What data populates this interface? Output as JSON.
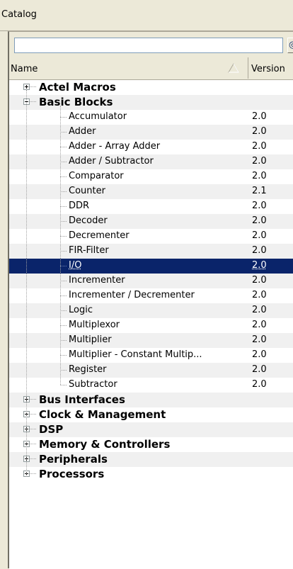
{
  "panel": {
    "title": "Catalog"
  },
  "search": {
    "value": ""
  },
  "columns": {
    "name": "Name",
    "version": "Version"
  },
  "tree": [
    {
      "label": "Actel Macros",
      "expanded": false,
      "children": []
    },
    {
      "label": "Basic Blocks",
      "expanded": true,
      "children": [
        {
          "label": "Accumulator",
          "version": "2.0"
        },
        {
          "label": "Adder",
          "version": "2.0"
        },
        {
          "label": "Adder - Array Adder",
          "version": "2.0"
        },
        {
          "label": "Adder / Subtractor",
          "version": "2.0"
        },
        {
          "label": "Comparator",
          "version": "2.0"
        },
        {
          "label": "Counter",
          "version": "2.1"
        },
        {
          "label": "DDR",
          "version": "2.0"
        },
        {
          "label": "Decoder",
          "version": "2.0"
        },
        {
          "label": "Decrementer",
          "version": "2.0"
        },
        {
          "label": "FIR-Filter",
          "version": "2.0"
        },
        {
          "label": "I/O",
          "version": "2.0",
          "selected": true
        },
        {
          "label": "Incrementer",
          "version": "2.0"
        },
        {
          "label": "Incrementer / Decrementer",
          "version": "2.0"
        },
        {
          "label": "Logic",
          "version": "2.0"
        },
        {
          "label": "Multiplexor",
          "version": "2.0"
        },
        {
          "label": "Multiplier",
          "version": "2.0"
        },
        {
          "label": "Multiplier - Constant Multip...",
          "version": "2.0"
        },
        {
          "label": "Register",
          "version": "2.0"
        },
        {
          "label": "Subtractor",
          "version": "2.0"
        }
      ]
    },
    {
      "label": "Bus Interfaces",
      "expanded": false,
      "children": []
    },
    {
      "label": "Clock & Management",
      "expanded": false,
      "children": []
    },
    {
      "label": "DSP",
      "expanded": false,
      "children": []
    },
    {
      "label": "Memory & Controllers",
      "expanded": false,
      "children": []
    },
    {
      "label": "Peripherals",
      "expanded": false,
      "children": []
    },
    {
      "label": "Processors",
      "expanded": false,
      "children": []
    }
  ],
  "colors": {
    "selection": "#0a246a",
    "alt_row": "#f0f0f0",
    "chrome": "#ece9d8"
  },
  "icons": {
    "expander": "plus-minus-box",
    "sort": "triangle-up",
    "search": "search-button"
  }
}
